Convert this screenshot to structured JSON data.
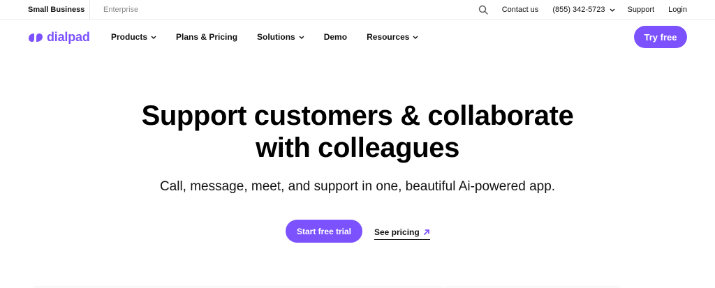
{
  "utility": {
    "small_business": "Small Business",
    "enterprise": "Enterprise",
    "contact_us": "Contact us",
    "phone": "(855) 342-5723",
    "support": "Support",
    "login": "Login"
  },
  "nav": {
    "logo_text": "dialpad",
    "items": [
      {
        "label": "Products",
        "has_dropdown": true
      },
      {
        "label": "Plans & Pricing",
        "has_dropdown": false
      },
      {
        "label": "Solutions",
        "has_dropdown": true
      },
      {
        "label": "Demo",
        "has_dropdown": false
      },
      {
        "label": "Resources",
        "has_dropdown": true
      }
    ],
    "cta": "Try free"
  },
  "hero": {
    "title_line1": "Support customers & collaborate",
    "title_line2": "with colleagues",
    "subtitle": "Call, message, meet, and support in one, beautiful Ai-powered app.",
    "primary_cta": "Start free trial",
    "secondary_cta": "See pricing"
  },
  "colors": {
    "brand": "#7c52ff",
    "text": "#111111",
    "muted": "#8a8a8a"
  },
  "icons": {
    "search": "search-icon",
    "chevron": "chevron-down-icon",
    "arrow": "arrow-up-right-icon",
    "logo": "dialpad-logo-icon"
  }
}
